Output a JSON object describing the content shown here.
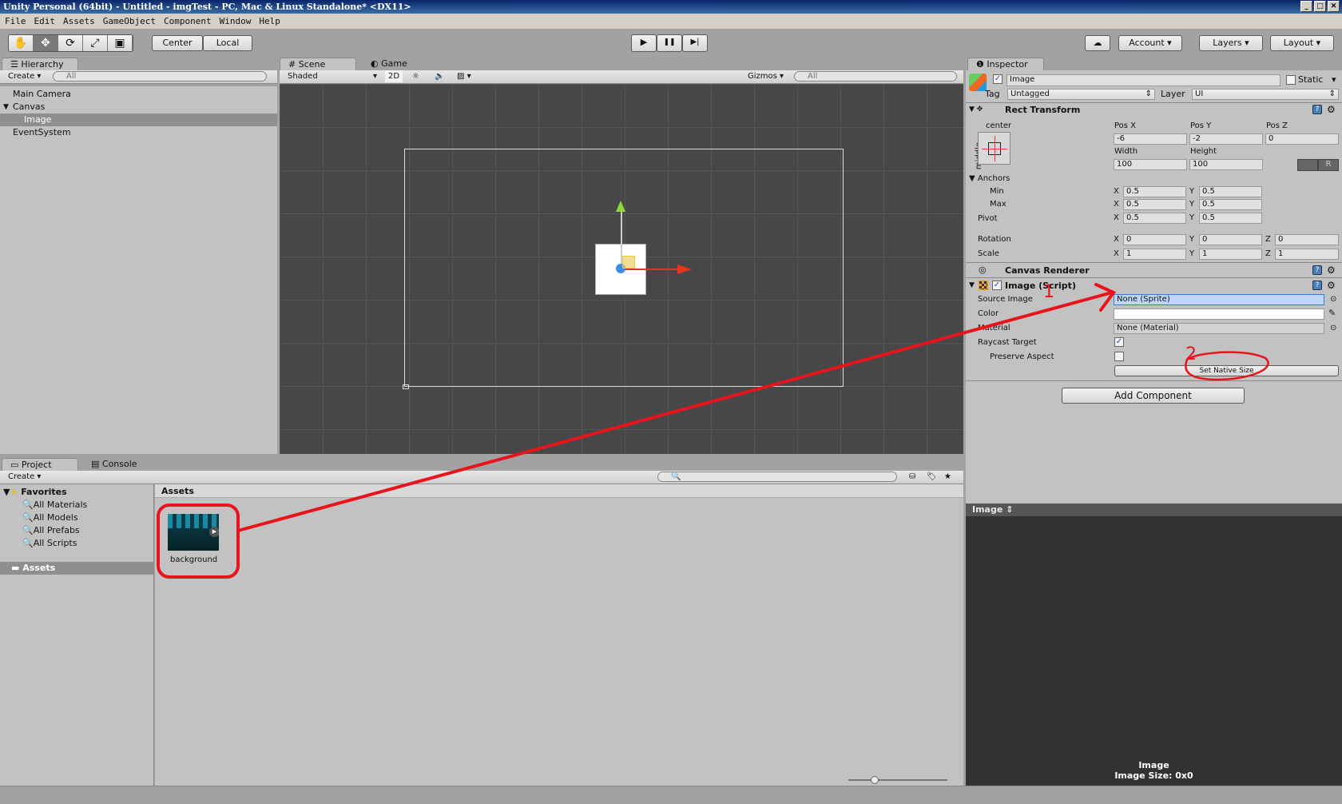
{
  "window": {
    "title": "Unity Personal (64bit) - Untitled - imgTest - PC, Mac & Linux Standalone* <DX11>",
    "minimize": "_",
    "maximize": "□",
    "close": "✕"
  },
  "menu": [
    "File",
    "Edit",
    "Assets",
    "GameObject",
    "Component",
    "Window",
    "Help"
  ],
  "toolbar": {
    "tools": [
      "✋",
      "✥",
      "⟳",
      "⤢",
      "▣"
    ],
    "pivot": "Center",
    "space": "Local",
    "play": "▶",
    "pause": "❚❚",
    "step": "▶|",
    "cloud": "☁",
    "account": "Account",
    "layers": "Layers",
    "layout": "Layout"
  },
  "hierarchy": {
    "tab": "Hierarchy",
    "create": "Create",
    "search": "All",
    "items": [
      {
        "label": "Main Camera",
        "depth": 0
      },
      {
        "label": "Canvas",
        "depth": 0,
        "expanded": true
      },
      {
        "label": "Image",
        "depth": 1,
        "selected": true
      },
      {
        "label": "EventSystem",
        "depth": 0
      }
    ]
  },
  "scene": {
    "tabs": [
      "Scene",
      "Game"
    ],
    "shading": "Shaded",
    "mode2d": "2D",
    "gizmos": "Gizmos",
    "search": "All"
  },
  "inspector": {
    "tab": "Inspector",
    "object_name": "Image",
    "active": true,
    "static_label": "Static",
    "tag_label": "Tag",
    "tag": "Untagged",
    "layer_label": "Layer",
    "layer": "UI",
    "rect_transform": {
      "title": "Rect Transform",
      "anchor_h": "center",
      "anchor_v": "middle",
      "posx_label": "Pos X",
      "posy_label": "Pos Y",
      "posz_label": "Pos Z",
      "posx": "-6",
      "posy": "-2",
      "posz": "0",
      "width_label": "Width",
      "height_label": "Height",
      "width": "100",
      "height": "100",
      "r_btn": "R",
      "anchors_label": "Anchors",
      "min_label": "Min",
      "max_label": "Max",
      "pivot_label": "Pivot",
      "rotation_label": "Rotation",
      "scale_label": "Scale",
      "x": "X",
      "y": "Y",
      "z": "Z",
      "min_x": "0.5",
      "min_y": "0.5",
      "max_x": "0.5",
      "max_y": "0.5",
      "pivot_x": "0.5",
      "pivot_y": "0.5",
      "rot_x": "0",
      "rot_y": "0",
      "rot_z": "0",
      "scale_x": "1",
      "scale_y": "1",
      "scale_z": "1"
    },
    "canvas_renderer": {
      "title": "Canvas Renderer"
    },
    "image_script": {
      "title": "Image (Script)",
      "enabled": true,
      "source_label": "Source Image",
      "source": "None (Sprite)",
      "color_label": "Color",
      "color": "#ffffff",
      "material_label": "Material",
      "material": "None (Material)",
      "raycast_label": "Raycast Target",
      "raycast": true,
      "preserve_label": "Preserve Aspect",
      "preserve": false,
      "native_btn": "Set Native Size"
    },
    "add_component": "Add Component",
    "preview": {
      "title": "Image",
      "name": "Image",
      "size": "Image Size: 0x0"
    }
  },
  "project": {
    "tabs": [
      "Project",
      "Console"
    ],
    "create": "Create",
    "favorites": "Favorites",
    "fav_items": [
      "All Materials",
      "All Models",
      "All Prefabs",
      "All Scripts"
    ],
    "assets_root": "Assets",
    "breadcrumb": "Assets",
    "asset": {
      "name": "background"
    }
  },
  "annotations": {
    "color": "#e8141c",
    "mark1": "1",
    "mark2": "2"
  }
}
